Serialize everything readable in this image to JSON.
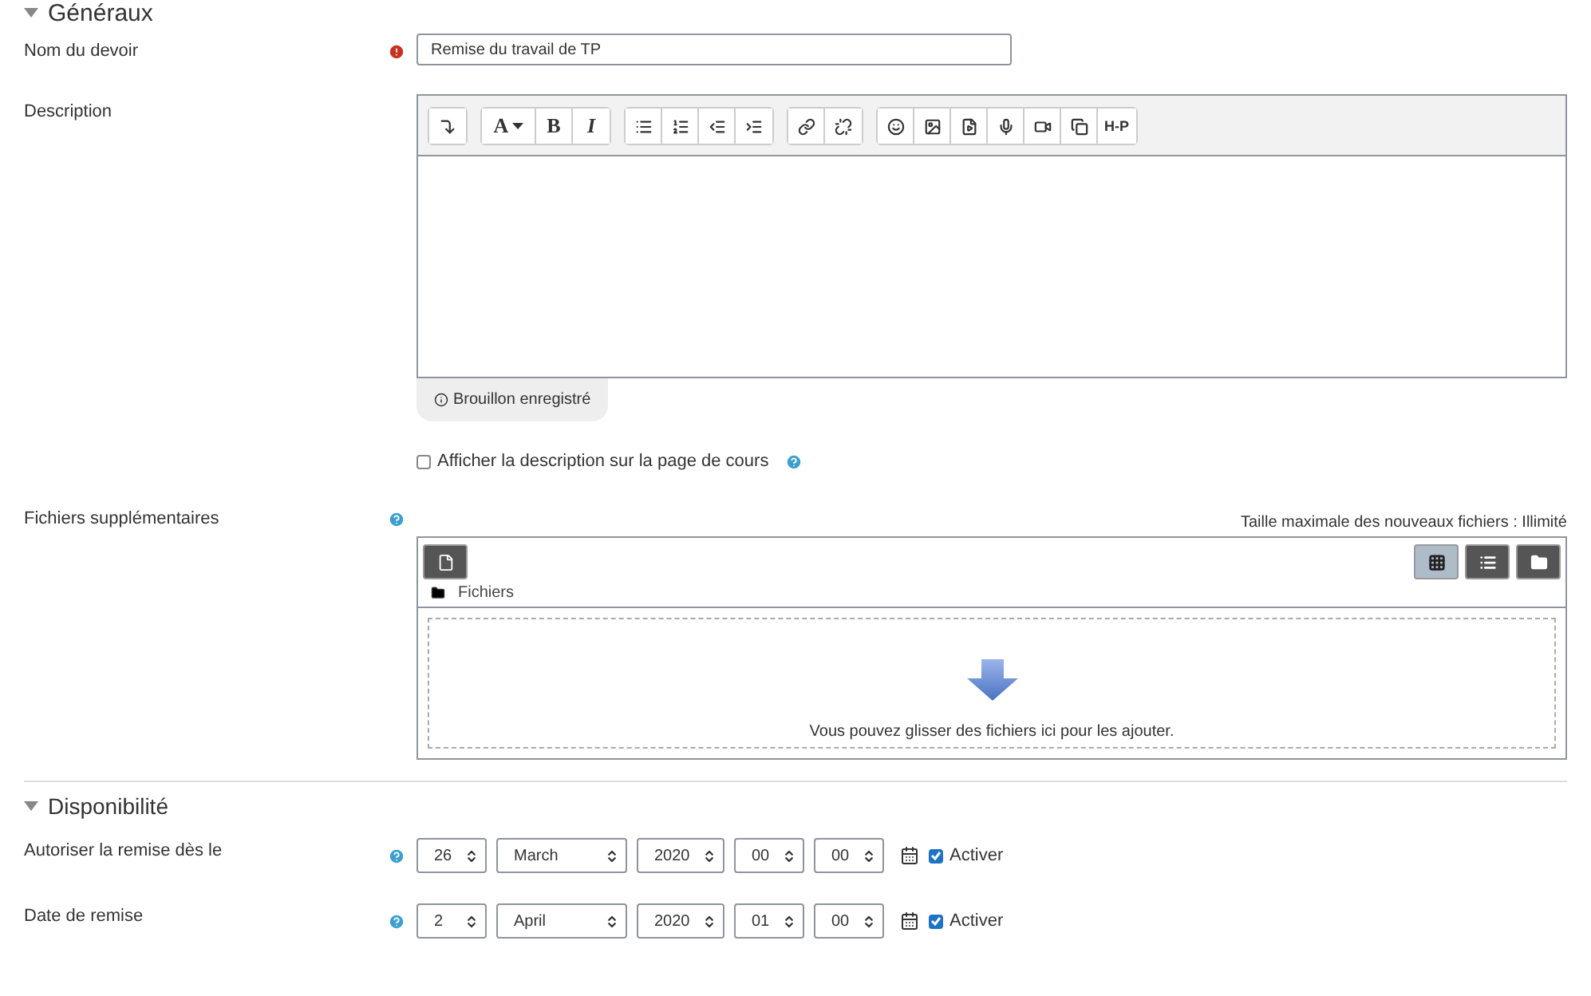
{
  "general": {
    "title": "Généraux",
    "expanded": true,
    "name_field": {
      "label": "Nom du devoir",
      "value": "Remise du travail de TP",
      "required": true
    },
    "description": {
      "label": "Description",
      "toolbar": [
        [
          {
            "kind": "redo"
          }
        ],
        [
          {
            "kind": "font",
            "label": "A"
          },
          {
            "kind": "bold",
            "label": "B"
          },
          {
            "kind": "italic",
            "label": "I"
          }
        ],
        [
          {
            "kind": "bullets"
          },
          {
            "kind": "numbers"
          },
          {
            "kind": "outdent"
          },
          {
            "kind": "indent"
          }
        ],
        [
          {
            "kind": "link"
          },
          {
            "kind": "unlink"
          }
        ],
        [
          {
            "kind": "emoji"
          },
          {
            "kind": "image"
          },
          {
            "kind": "media"
          },
          {
            "kind": "audio"
          },
          {
            "kind": "video"
          },
          {
            "kind": "copy"
          },
          {
            "kind": "h5p",
            "label": "H-P"
          }
        ]
      ],
      "draft_status": "Brouillon enregistré"
    },
    "show_description": {
      "label": "Afficher la description sur la page de cours",
      "checked": false
    },
    "files": {
      "label": "Fichiers supplémentaires",
      "max_size": "Taille maximale des nouveaux fichiers : Illimité",
      "path": "Fichiers",
      "dropzone": "Vous pouvez glisser des fichiers ici pour les ajouter.",
      "views": [
        {
          "kind": "icons",
          "selected": true
        },
        {
          "kind": "list",
          "selected": false
        },
        {
          "kind": "tree",
          "selected": false
        }
      ]
    }
  },
  "availability": {
    "title": "Disponibilité",
    "expanded": true,
    "rows": [
      {
        "label": "Autoriser la remise dès le",
        "day": "26",
        "month": "March",
        "year": "2020",
        "hour": "00",
        "minute": "00",
        "enable_label": "Activer",
        "enabled": true
      },
      {
        "label": "Date de remise",
        "day": "2",
        "month": "April",
        "year": "2020",
        "hour": "01",
        "minute": "00",
        "enable_label": "Activer",
        "enabled": true
      }
    ]
  }
}
